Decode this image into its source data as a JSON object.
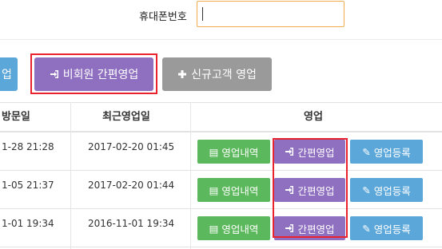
{
  "search": {
    "phone_label": "휴대폰번호",
    "phone_value": ""
  },
  "actions": {
    "cut_button_label": "업",
    "nonmember_button_label": "비회원 간편영업",
    "new_customer_button_label": "신규고객 영업"
  },
  "table": {
    "headers": {
      "visit": "방문일",
      "recent_sales": "최근영업일",
      "sales": "영업"
    },
    "rows": [
      {
        "visit": "1-28 21:28",
        "recent_sales": "2017-02-20 01:45"
      },
      {
        "visit": "1-05 21:37",
        "recent_sales": "2017-02-20 01:44"
      },
      {
        "visit": "1-01 19:34",
        "recent_sales": "2016-11-01 19:34"
      }
    ],
    "row_buttons": {
      "history": "영업내역",
      "quick": "간편영업",
      "register": "영업등록"
    }
  },
  "colors": {
    "purple": "#8f6fc0",
    "green": "#5cb85c",
    "blue": "#5ba7d9",
    "gray": "#9a9a9a",
    "highlight": "#e8232f",
    "input_border": "#f0ad4e"
  },
  "icons": {
    "enter": "sign-in-icon",
    "plus": "plus-icon",
    "list": "list-icon",
    "pencil": "pencil-icon"
  }
}
